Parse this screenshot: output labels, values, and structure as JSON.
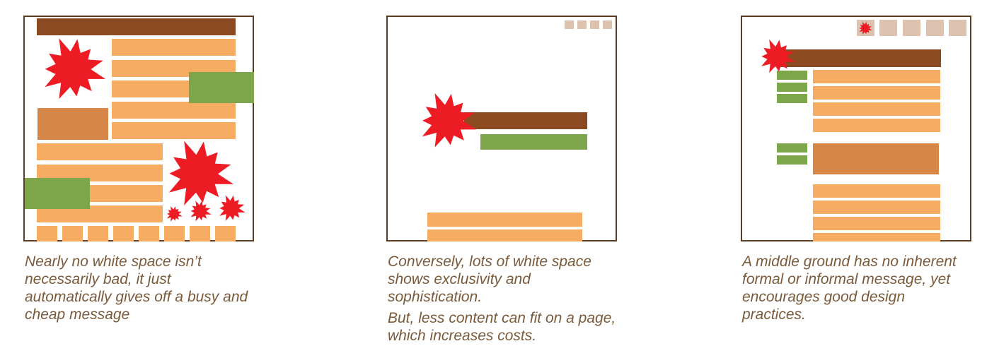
{
  "colors": {
    "border": "#5a3d22",
    "dark_brown": "#8c4a22",
    "light_orange": "#f6ab62",
    "mid_orange": "#d68747",
    "green": "#7da64b",
    "nav_beige": "#dcc2af",
    "burst_red": "#ed1c24",
    "caption_text": "#7a5a3a"
  },
  "panels": [
    {
      "id": "busy",
      "caption": "Nearly no white space isn’t necessarily bad, it just automatically gives off a busy and cheap message"
    },
    {
      "id": "sparse",
      "caption_1": "Conversely, lots of white space shows exclusivity and sophistication.",
      "caption_2": "But, less content can fit on a page, which increases costs."
    },
    {
      "id": "balanced",
      "caption": "A middle ground has no inherent formal or informal message, yet encourages good design practices."
    }
  ]
}
